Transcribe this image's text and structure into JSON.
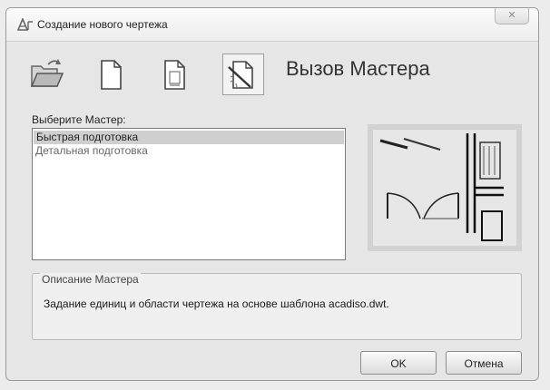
{
  "window": {
    "title": "Создание нового чертежа",
    "close_glyph": "✕"
  },
  "toolbar": {
    "buttons": [
      {
        "icon": "open-folder-icon"
      },
      {
        "icon": "blank-page-icon"
      },
      {
        "icon": "template-page-icon"
      },
      {
        "icon": "wizard-icon",
        "active": true
      }
    ]
  },
  "main": {
    "heading": "Вызов Мастера",
    "list_label": "Выберите Мастер:",
    "items": [
      {
        "label": "Быстрая подготовка",
        "selected": true
      },
      {
        "label": "Детальная подготовка",
        "selected": false
      }
    ]
  },
  "description": {
    "label": "Описание Мастера",
    "text": "Задание единиц и области чертежа на основе шаблона acadiso.dwt."
  },
  "buttons": {
    "ok": "OK",
    "cancel": "Отмена"
  }
}
